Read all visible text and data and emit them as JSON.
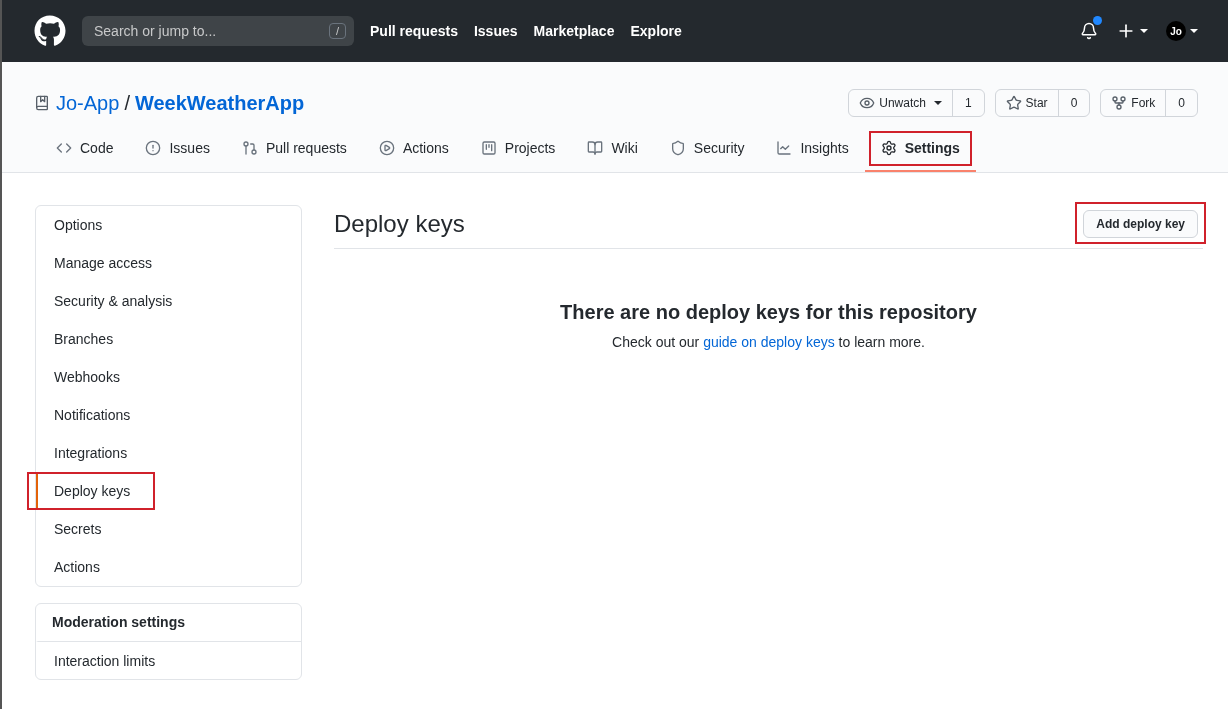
{
  "topnav": {
    "search": {
      "placeholder": "Search or jump to...",
      "shortcut": "/"
    },
    "links": [
      "Pull requests",
      "Issues",
      "Marketplace",
      "Explore"
    ],
    "notification_unread": true,
    "avatar": "Jo"
  },
  "repo": {
    "owner": "Jo-App",
    "separator": "/",
    "name": "WeekWeatherApp",
    "actions": [
      {
        "kind": "watch",
        "label": "Unwatch",
        "count": "1"
      },
      {
        "kind": "star",
        "label": "Star",
        "count": "0"
      },
      {
        "kind": "fork",
        "label": "Fork",
        "count": "0"
      }
    ]
  },
  "tabs": [
    {
      "kind": "code",
      "label": "Code",
      "selected": false,
      "highlighted": false
    },
    {
      "kind": "issues",
      "label": "Issues",
      "selected": false,
      "highlighted": false
    },
    {
      "kind": "pulls",
      "label": "Pull requests",
      "selected": false,
      "highlighted": false
    },
    {
      "kind": "actions",
      "label": "Actions",
      "selected": false,
      "highlighted": false
    },
    {
      "kind": "projects",
      "label": "Projects",
      "selected": false,
      "highlighted": false
    },
    {
      "kind": "wiki",
      "label": "Wiki",
      "selected": false,
      "highlighted": false
    },
    {
      "kind": "security",
      "label": "Security",
      "selected": false,
      "highlighted": false
    },
    {
      "kind": "insights",
      "label": "Insights",
      "selected": false,
      "highlighted": false
    },
    {
      "kind": "settings",
      "label": "Settings",
      "selected": true,
      "highlighted": true
    }
  ],
  "sidebar": {
    "items": [
      {
        "label": "Options",
        "selected": false,
        "highlighted": false
      },
      {
        "label": "Manage access",
        "selected": false,
        "highlighted": false
      },
      {
        "label": "Security & analysis",
        "selected": false,
        "highlighted": false
      },
      {
        "label": "Branches",
        "selected": false,
        "highlighted": false
      },
      {
        "label": "Webhooks",
        "selected": false,
        "highlighted": false
      },
      {
        "label": "Notifications",
        "selected": false,
        "highlighted": false
      },
      {
        "label": "Integrations",
        "selected": false,
        "highlighted": false
      },
      {
        "label": "Deploy keys",
        "selected": true,
        "highlighted": true
      },
      {
        "label": "Secrets",
        "selected": false,
        "highlighted": false
      },
      {
        "label": "Actions",
        "selected": false,
        "highlighted": false
      }
    ],
    "moderation": {
      "heading": "Moderation settings",
      "items": [
        {
          "label": "Interaction limits",
          "selected": false,
          "highlighted": false
        }
      ]
    }
  },
  "main": {
    "title": "Deploy keys",
    "add_button": {
      "label": "Add deploy key",
      "highlighted": true
    },
    "empty_title": "There are no deploy keys for this repository",
    "empty_text_before": "Check out our",
    "empty_link": "guide on deploy keys",
    "empty_text_after": "to learn more."
  }
}
